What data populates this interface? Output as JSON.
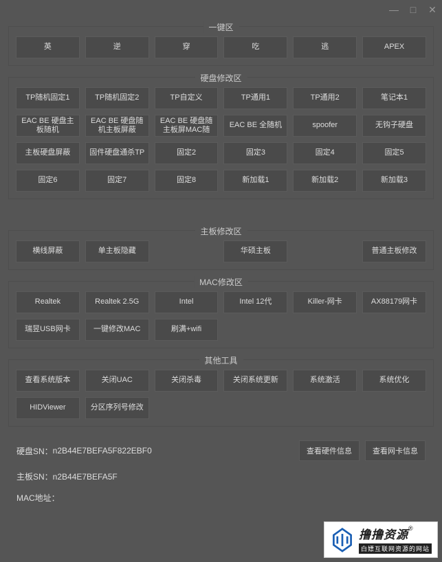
{
  "titlebar": {
    "minimize": "—",
    "maximize": "□",
    "close": "✕"
  },
  "sections": {
    "onekey": {
      "title": "一键区",
      "buttons": [
        "英",
        "逆",
        "穿",
        "吃",
        "逃",
        "APEX"
      ]
    },
    "disk": {
      "title": "硬盘修改区",
      "rows": [
        [
          "TP随机固定1",
          "TP随机固定2",
          "TP自定义",
          "TP通用1",
          "TP通用2",
          "笔记本1"
        ],
        [
          "EAC BE 硬盘主板随机",
          "EAC BE 硬盘随机主板屏蔽",
          "EAC BE 硬盘随主板屏MAC随",
          "EAC BE 全随机",
          "spoofer",
          "无钩子硬盘"
        ],
        [
          "主板硬盘屏蔽",
          "固件硬盘通杀TP",
          "固定2",
          "固定3",
          "固定4",
          "固定5"
        ],
        [
          "固定6",
          "固定7",
          "固定8",
          "新加载1",
          "新加载2",
          "新加载3"
        ]
      ]
    },
    "mobo": {
      "title": "主板修改区",
      "buttons": [
        "横线屏蔽",
        "单主板隐藏",
        "",
        "华硕主板",
        "",
        "普通主板修改"
      ]
    },
    "mac": {
      "title": "MAC修改区",
      "rows": [
        [
          "Realtek",
          "Realtek 2.5G",
          "Intel",
          "Intel 12代",
          "Killer-网卡",
          "AX88179网卡"
        ],
        [
          "瑞昱USB网卡",
          "一键修改MAC",
          "刷满+wifi",
          "",
          "",
          ""
        ]
      ]
    },
    "other": {
      "title": "其他工具",
      "rows": [
        [
          "查看系统版本",
          "关闭UAC",
          "关闭杀毒",
          "关闭系统更新",
          "系统激活",
          "系统优化"
        ],
        [
          "HIDViewer",
          "分区序列号修改",
          "",
          "",
          "",
          ""
        ]
      ]
    }
  },
  "info": {
    "disk_label": "硬盘SN：",
    "disk_value": "n2B44E7BEFA5F822EBF0",
    "mobo_label": "主板SN：",
    "mobo_value": "n2B44E7BEFA5F",
    "mac_label": "MAC地址：",
    "mac_value": "",
    "btn_hwinfo": "查看硬件信息",
    "btn_netinfo": "查看网卡信息"
  },
  "watermark": {
    "main": "撸撸资源",
    "reg": "®",
    "sub": "白嫖互联网资源的网站"
  }
}
